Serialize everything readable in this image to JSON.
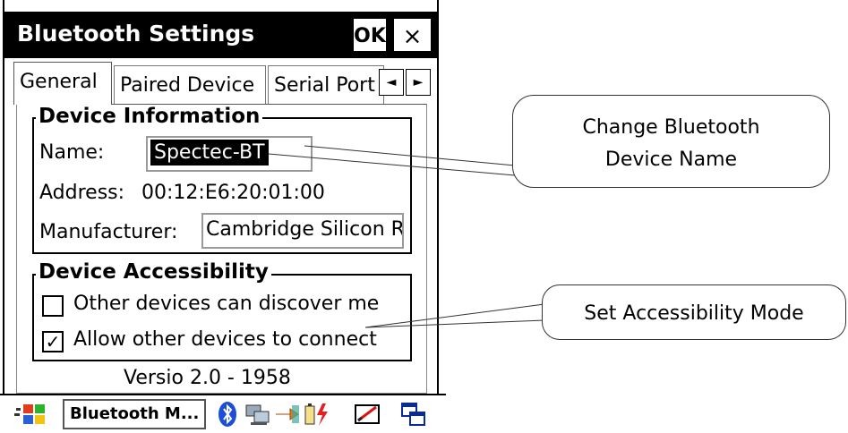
{
  "window": {
    "title": "Bluetooth Settings",
    "ok_label": "OK",
    "close_label": "×"
  },
  "tabs": [
    {
      "label": "General",
      "active": true
    },
    {
      "label": "Paired Device",
      "active": false
    },
    {
      "label": "Serial Port",
      "active": false
    }
  ],
  "tab_scroll": {
    "left": "◄",
    "right": "►"
  },
  "device_info": {
    "heading": "Device Information",
    "name_label": "Name:",
    "name_value": "Spectec-BT",
    "address_label": "Address:",
    "address_value": "00:12:E6:20:01:00",
    "manufacturer_label": "Manufacturer:",
    "manufacturer_value": "Cambridge Silicon R"
  },
  "accessibility": {
    "heading": "Device Accessibility",
    "discover_label": "Other devices can discover me",
    "discover_checked": false,
    "connect_label": "Allow other devices to connect",
    "connect_checked": true,
    "check_mark": "✓"
  },
  "version_text": "Versio  2.0 - 1958",
  "taskbar": {
    "app_button": "Bluetooth M..."
  },
  "callouts": {
    "rename_line1": "Change Bluetooth",
    "rename_line2": "Device Name",
    "access_text": "Set Accessibility Mode"
  }
}
